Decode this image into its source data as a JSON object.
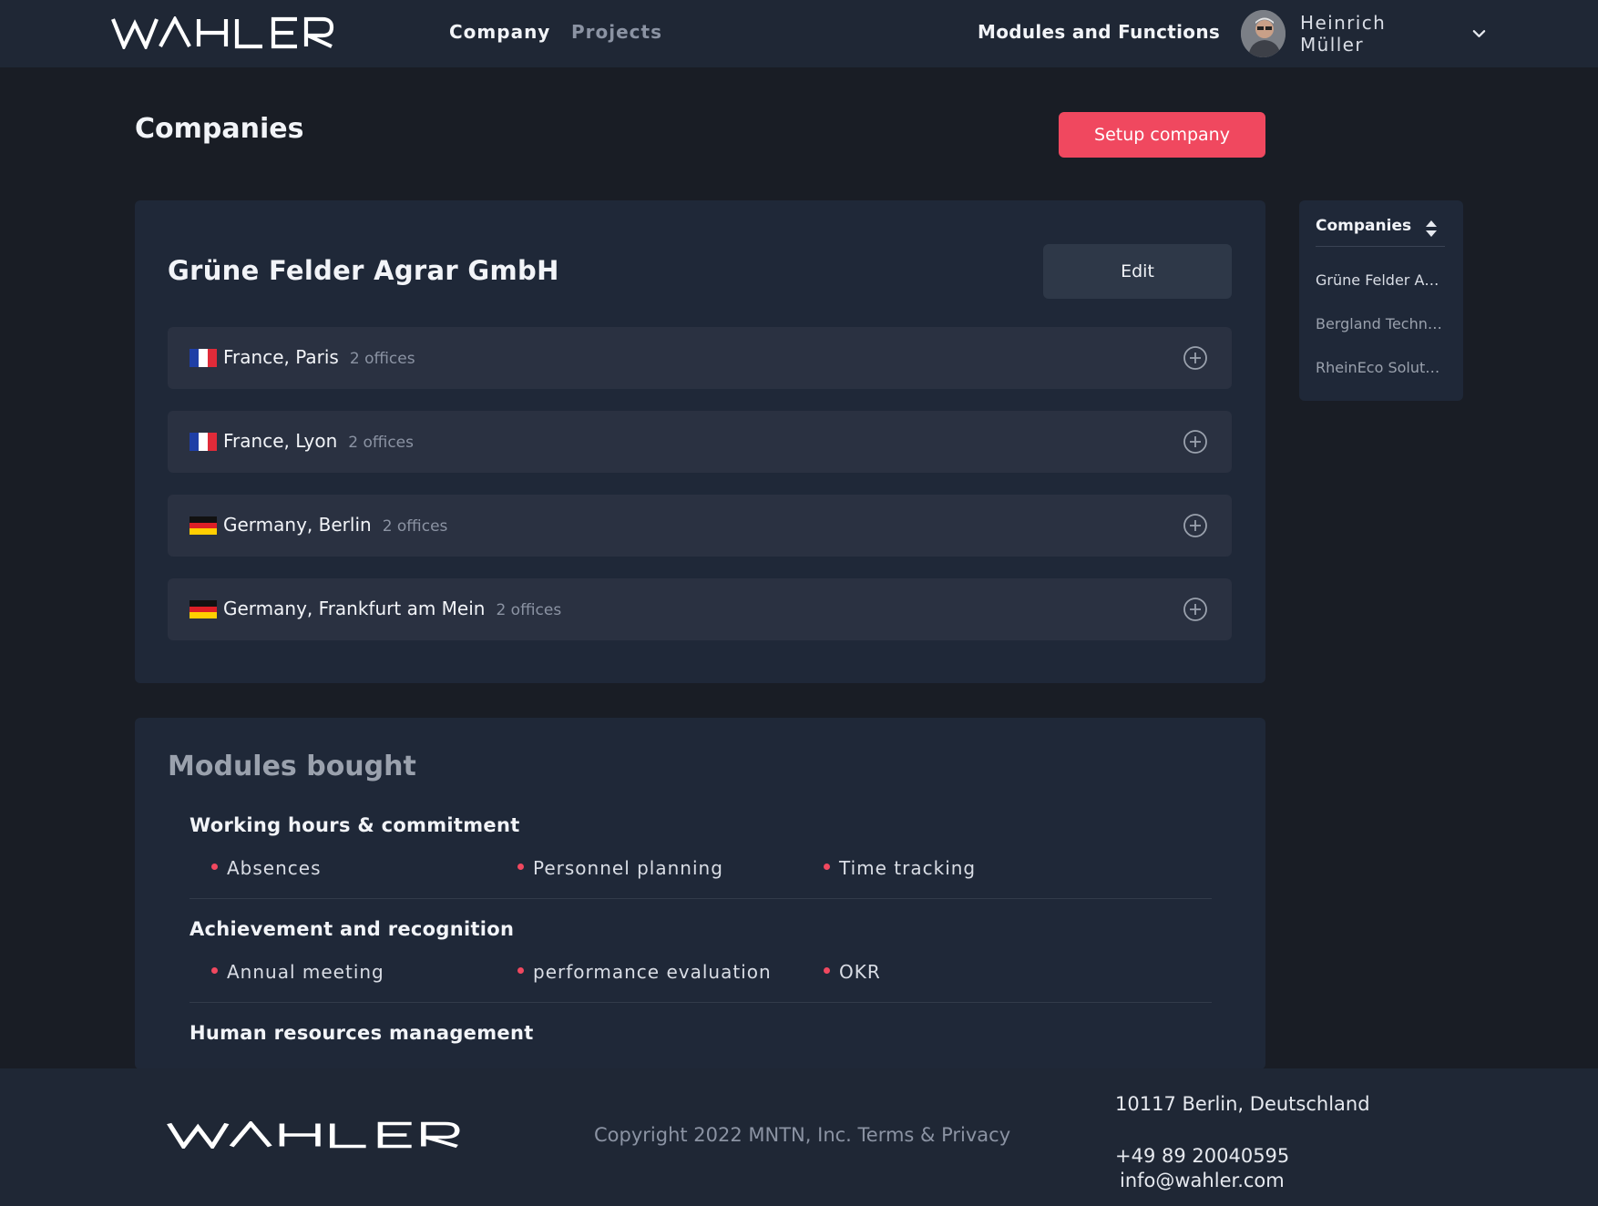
{
  "header": {
    "brand": "WAHLER",
    "nav": {
      "company": "Company",
      "projects": "Projects",
      "modules": "Modules and Functions"
    },
    "user": {
      "name": "Heinrich Müller"
    }
  },
  "page": {
    "title": "Companies",
    "setup_button": "Setup company"
  },
  "company": {
    "name": "Grüne Felder Agrar GmbH",
    "edit_button": "Edit",
    "locations": [
      {
        "name": "France, Paris",
        "offices": "2 offices",
        "flag": "fr"
      },
      {
        "name": "France, Lyon",
        "offices": "2 offices",
        "flag": "fr"
      },
      {
        "name": "Germany, Berlin",
        "offices": "2 offices",
        "flag": "de"
      },
      {
        "name": "Germany, Frankfurt am Mein",
        "offices": "2 offices",
        "flag": "de"
      }
    ]
  },
  "modules": {
    "title": "Modules bought",
    "groups": [
      {
        "title": "Working hours & commitment",
        "items": [
          "Absences",
          "Personnel planning",
          "Time tracking"
        ]
      },
      {
        "title": "Achievement and recognition",
        "items": [
          "Annual meeting",
          "performance evaluation",
          "OKR"
        ]
      },
      {
        "title": "Human resources management",
        "items": []
      }
    ]
  },
  "side_panel": {
    "heading": "Companies",
    "items": [
      "Grüne Felder Agrar GmbH",
      "Bergland Technik GmbH",
      "RheinEco Solutions GmbH"
    ]
  },
  "footer": {
    "brand": "WAHLER",
    "copyright": "Copyright 2022 MNTN, Inc. Terms & Privacy",
    "address": "10117 Berlin, Deutschland",
    "phone": "+49 89 20040595",
    "email": "info@wahler.com"
  },
  "colors": {
    "accent": "#f0485f",
    "background": "#191d25",
    "card": "#1f2838",
    "row": "#2a3141"
  }
}
